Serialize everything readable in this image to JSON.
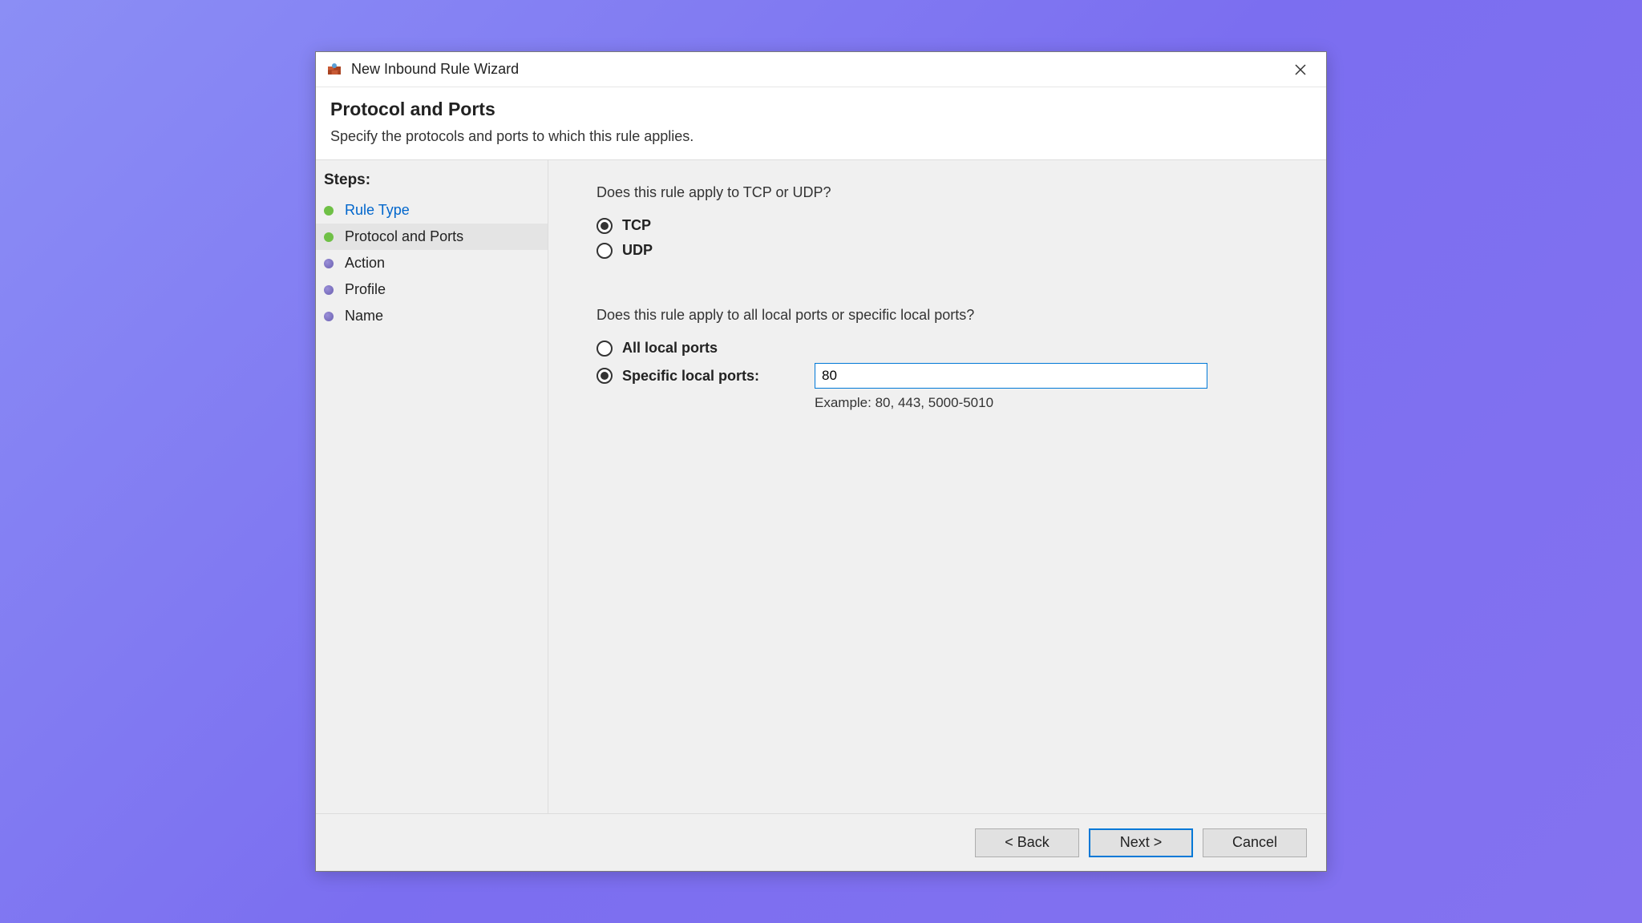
{
  "window": {
    "title": "New Inbound Rule Wizard"
  },
  "header": {
    "title": "Protocol and Ports",
    "subtitle": "Specify the protocols and ports to which this rule applies."
  },
  "sidebar": {
    "label": "Steps:",
    "items": [
      {
        "label": "Rule Type",
        "status": "done",
        "link": true
      },
      {
        "label": "Protocol and Ports",
        "status": "done",
        "current": true
      },
      {
        "label": "Action",
        "status": "pending"
      },
      {
        "label": "Profile",
        "status": "pending"
      },
      {
        "label": "Name",
        "status": "pending"
      }
    ]
  },
  "content": {
    "q1": "Does this rule apply to TCP or UDP?",
    "proto": {
      "tcp": "TCP",
      "udp": "UDP",
      "selected": "tcp"
    },
    "q2": "Does this rule apply to all local ports or specific local ports?",
    "ports": {
      "all": "All local ports",
      "specific": "Specific local ports:",
      "selected": "specific",
      "value": "80",
      "example": "Example: 80, 443, 5000-5010"
    }
  },
  "footer": {
    "back": "< Back",
    "next": "Next >",
    "cancel": "Cancel"
  }
}
